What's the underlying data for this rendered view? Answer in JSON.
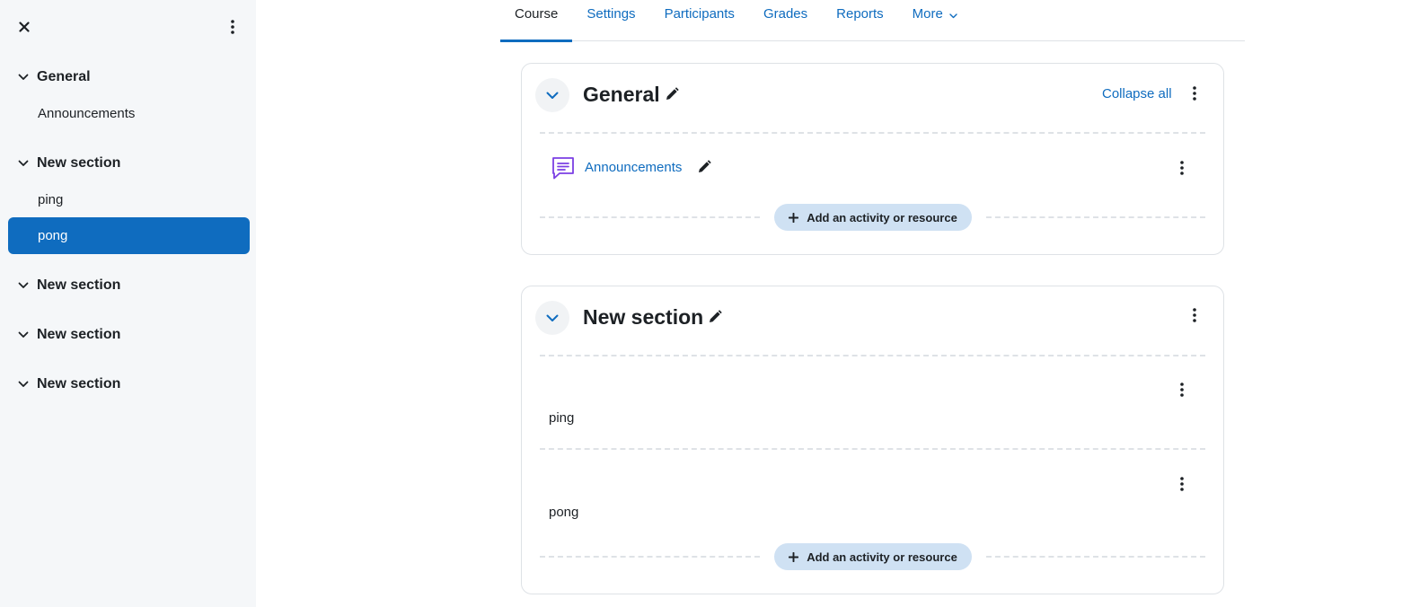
{
  "sidebar": {
    "sections": [
      {
        "title": "General",
        "items": [
          {
            "label": "Announcements",
            "active": false
          }
        ]
      },
      {
        "title": "New section",
        "items": [
          {
            "label": "ping",
            "active": false
          },
          {
            "label": "pong",
            "active": true
          }
        ]
      },
      {
        "title": "New section",
        "items": []
      },
      {
        "title": "New section",
        "items": []
      },
      {
        "title": "New section",
        "items": []
      }
    ]
  },
  "nav": {
    "tabs": [
      {
        "label": "Course",
        "active": true
      },
      {
        "label": "Settings",
        "active": false
      },
      {
        "label": "Participants",
        "active": false
      },
      {
        "label": "Grades",
        "active": false
      },
      {
        "label": "Reports",
        "active": false
      },
      {
        "label": "More",
        "active": false
      }
    ]
  },
  "sections": {
    "general": {
      "title": "General",
      "collapse_all": "Collapse all",
      "activity": "Announcements",
      "add_label": "Add an activity or resource"
    },
    "new_section": {
      "title": "New section",
      "items": [
        "ping",
        "pong"
      ],
      "add_label": "Add an activity or resource"
    }
  },
  "colors": {
    "accent": "#0f6cbf",
    "sidebar_bg": "#f5f7f9",
    "add_button_bg": "#cfe1f3",
    "forum_icon": "#7b3fe4"
  }
}
